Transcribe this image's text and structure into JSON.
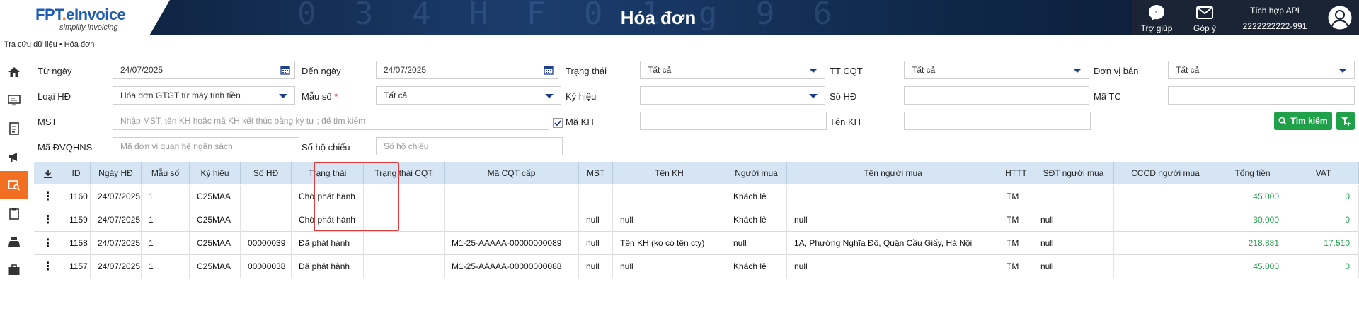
{
  "header": {
    "logo_fpt": "FPT",
    "logo_dot": ".",
    "logo_einvoice": "eInvoice",
    "logo_tagline": "simplify invoicing",
    "title": "Hóa đơn",
    "help_label": "Trợ giúp",
    "feedback_label": "Góp ý",
    "api_label": "Tích hợp API",
    "tax_code": "2222222222-991",
    "bg_digits": "0 3 4 H F 0 1 g 9 6"
  },
  "breadcrumb": ": Tra cứu dữ liệu • Hóa đơn",
  "filters": {
    "tu_ngay_label": "Từ ngày",
    "tu_ngay_value": "24/07/2025",
    "den_ngay_label": "Đến ngày",
    "den_ngay_value": "24/07/2025",
    "trang_thai_label": "Trạng thái",
    "trang_thai_value": "Tất cả",
    "tt_cqt_label": "TT CQT",
    "tt_cqt_value": "Tất cả",
    "don_vi_ban_label": "Đơn vị bán",
    "don_vi_ban_value": "Tất cả",
    "loai_hd_label": "Loại HĐ",
    "loai_hd_value": "Hóa đơn GTGT từ máy tính tiền",
    "mau_so_label": "Mẫu số",
    "mau_so_required": "*",
    "mau_so_value": "Tất cả",
    "ky_hieu_label": "Ký hiệu",
    "ky_hieu_value": "",
    "so_hd_label": "Số HĐ",
    "so_hd_value": "",
    "ma_tc_label": "Mã TC",
    "ma_tc_value": "",
    "mst_label": "MST",
    "mst_placeholder": "Nhập MST, tên KH hoặc mã KH kết thúc bằng ký tự ; để tìm kiếm",
    "ma_kh_label": "Mã KH",
    "ma_kh_value": "",
    "ten_kh_label": "Tên KH",
    "ten_kh_value": "",
    "ma_dvqhns_label": "Mã ĐVQHNS",
    "ma_dvqhns_placeholder": "Mã đơn vị quan hệ ngân sách",
    "so_ho_chieu_label": "Số hộ chiếu",
    "so_ho_chieu_placeholder": "Số hộ chiếu",
    "search_label": "Tìm kiếm"
  },
  "table": {
    "headers": [
      "",
      "ID",
      "Ngày HĐ",
      "Mẫu số",
      "Ký hiệu",
      "Số HĐ",
      "Trạng thái",
      "Trạng thái CQT",
      "Mã CQT cấp",
      "MST",
      "Tên KH",
      "Người mua",
      "Tên người mua",
      "HTTT",
      "SĐT người mua",
      "CCCD người mua",
      "Tổng tiền",
      "VAT"
    ],
    "rows": [
      {
        "id": "1160",
        "ngay": "24/07/2025",
        "mau_so": "1",
        "ky_hieu": "C25MAA",
        "so_hd": "",
        "trang_thai": "Chờ phát hành",
        "tt_cqt": "",
        "ma_cqt": "",
        "mst": "",
        "ten_kh": "",
        "nguoi_mua": "Khách lẻ",
        "ten_nguoi_mua": "",
        "httt": "TM",
        "sdt": "",
        "cccd": "",
        "tong_tien": "45.000",
        "vat": "0"
      },
      {
        "id": "1159",
        "ngay": "24/07/2025",
        "mau_so": "1",
        "ky_hieu": "C25MAA",
        "so_hd": "",
        "trang_thai": "Chờ phát hành",
        "tt_cqt": "",
        "ma_cqt": "",
        "mst": "null",
        "ten_kh": "null",
        "nguoi_mua": "Khách lẻ",
        "ten_nguoi_mua": "null",
        "httt": "TM",
        "sdt": "null",
        "cccd": "",
        "tong_tien": "30.000",
        "vat": "0"
      },
      {
        "id": "1158",
        "ngay": "24/07/2025",
        "mau_so": "1",
        "ky_hieu": "C25MAA",
        "so_hd": "00000039",
        "trang_thai": "Đã phát hành",
        "tt_cqt": "",
        "ma_cqt": "M1-25-AAAAA-00000000089",
        "mst": "null",
        "ten_kh": "Tên KH (ko có tên cty)",
        "nguoi_mua": "null",
        "ten_nguoi_mua": "1A, Phường Nghĩa Đô, Quận Cầu Giấy, Hà Nội",
        "httt": "TM",
        "sdt": "null",
        "cccd": "",
        "tong_tien": "218.881",
        "vat": "17.510"
      },
      {
        "id": "1157",
        "ngay": "24/07/2025",
        "mau_so": "1",
        "ky_hieu": "C25MAA",
        "so_hd": "00000038",
        "trang_thai": "Đã phát hành",
        "tt_cqt": "",
        "ma_cqt": "M1-25-AAAAA-00000000088",
        "mst": "null",
        "ten_kh": "null",
        "nguoi_mua": "Khách lẻ",
        "ten_nguoi_mua": "null",
        "httt": "TM",
        "sdt": "null",
        "cccd": "",
        "tong_tien": "45.000",
        "vat": "0"
      }
    ]
  },
  "colors": {
    "accent": "#f26f21",
    "brand_blue": "#1e5cb3",
    "success": "#1fa14a",
    "highlight": "#e03b3b",
    "table_header": "#d6e5f4"
  }
}
